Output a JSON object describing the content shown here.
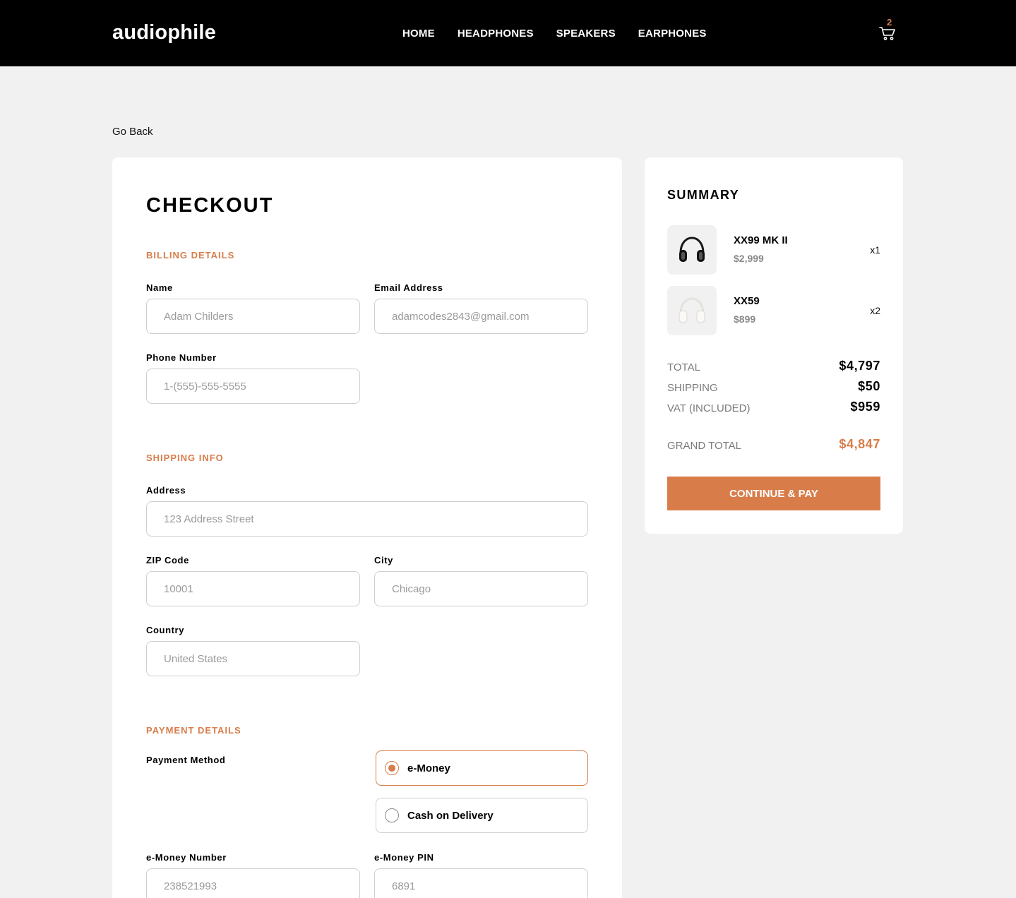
{
  "header": {
    "logo": "audiophile",
    "nav": [
      "HOME",
      "HEADPHONES",
      "SPEAKERS",
      "EARPHONES"
    ],
    "cart_count": "2"
  },
  "go_back": "Go Back",
  "checkout": {
    "title": "CHECKOUT",
    "billing": {
      "title": "BILLING DETAILS",
      "name_label": "Name",
      "name_placeholder": "Adam Childers",
      "email_label": "Email Address",
      "email_placeholder": "adamcodes2843@gmail.com",
      "phone_label": "Phone Number",
      "phone_placeholder": "1-(555)-555-5555"
    },
    "shipping": {
      "title": "SHIPPING INFO",
      "address_label": "Address",
      "address_placeholder": "123 Address Street",
      "zip_label": "ZIP Code",
      "zip_placeholder": "10001",
      "city_label": "City",
      "city_placeholder": "Chicago",
      "country_label": "Country",
      "country_placeholder": "United States"
    },
    "payment": {
      "title": "PAYMENT DETAILS",
      "method_label": "Payment Method",
      "options": [
        "e-Money",
        "Cash on Delivery"
      ],
      "selected": "e-Money",
      "emoney_number_label": "e-Money Number",
      "emoney_number_placeholder": "238521993",
      "emoney_pin_label": "e-Money PIN",
      "emoney_pin_placeholder": "6891"
    }
  },
  "summary": {
    "title": "SUMMARY",
    "items": [
      {
        "name": "XX99 MK II",
        "price": "$2,999",
        "qty": "x1",
        "icon": "headphones-black-icon"
      },
      {
        "name": "XX59",
        "price": "$899",
        "qty": "x2",
        "icon": "headphones-white-icon"
      }
    ],
    "total_label": "TOTAL",
    "total_value": "$4,797",
    "shipping_label": "SHIPPING",
    "shipping_value": "$50",
    "vat_label": "VAT (INCLUDED)",
    "vat_value": "$959",
    "grand_total_label": "GRAND TOTAL",
    "grand_total_value": "$4,847",
    "button_label": "CONTINUE & PAY"
  },
  "colors": {
    "accent": "#d87d4a",
    "header_bg": "#000000",
    "page_bg": "#f1f1f1"
  }
}
